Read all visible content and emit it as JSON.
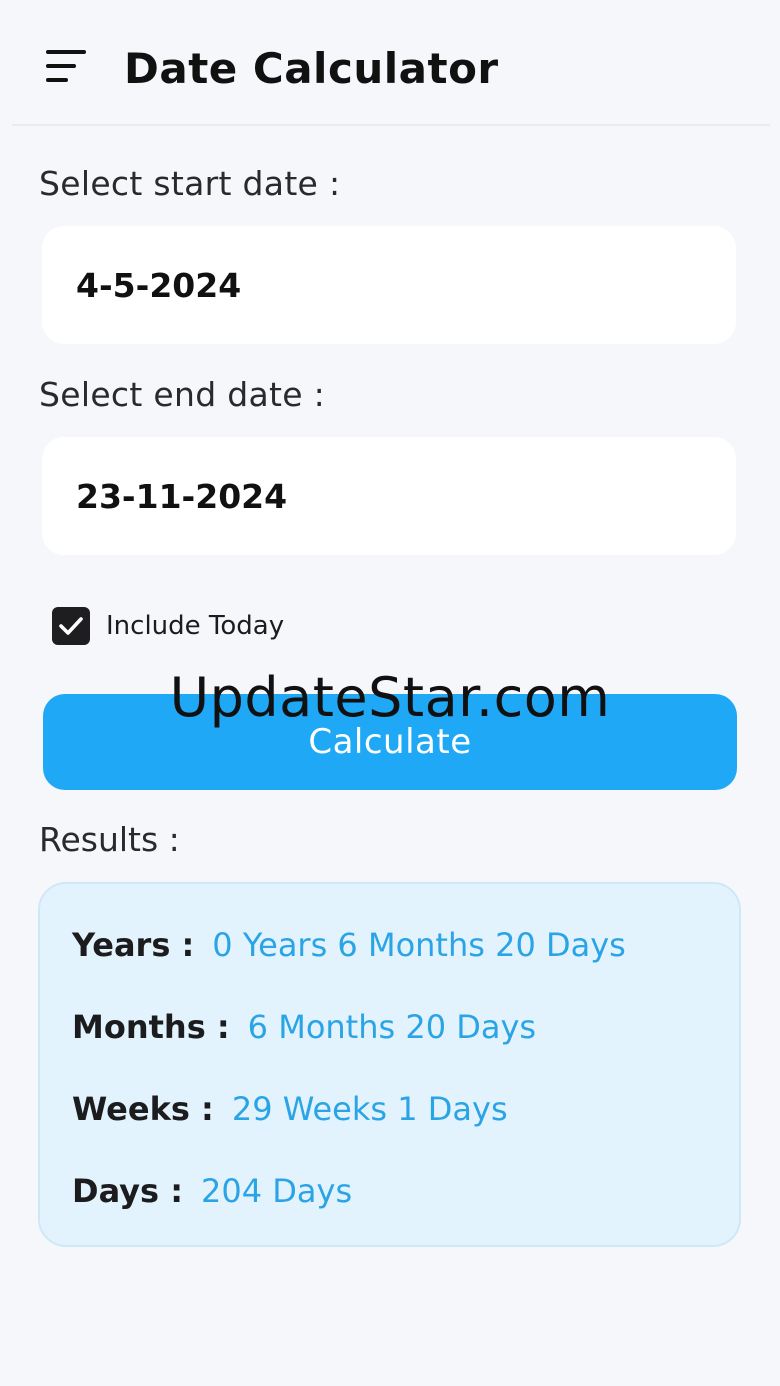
{
  "app_bar": {
    "menu_icon": "menu-icon",
    "title": "Date Calculator"
  },
  "start_date": {
    "label": "Select start date :",
    "value": "4-5-2024"
  },
  "end_date": {
    "label": "Select end date :",
    "value": "23-11-2024"
  },
  "include_today": {
    "label": "Include Today",
    "checked": true
  },
  "calculate_button": {
    "label": "Calculate",
    "color": "#1fa8f5"
  },
  "watermark": "UpdateStar.com",
  "results": {
    "heading": "Results :",
    "rows": [
      {
        "key": "Years :",
        "value": "0 Years 6 Months 20 Days"
      },
      {
        "key": "Months :",
        "value": "6 Months 20 Days"
      },
      {
        "key": "Weeks :",
        "value": "29 Weeks 1 Days"
      },
      {
        "key": "Days :",
        "value": "204 Days"
      }
    ],
    "value_color": "#2ba4e6",
    "card_color": "#e2f3fd"
  }
}
